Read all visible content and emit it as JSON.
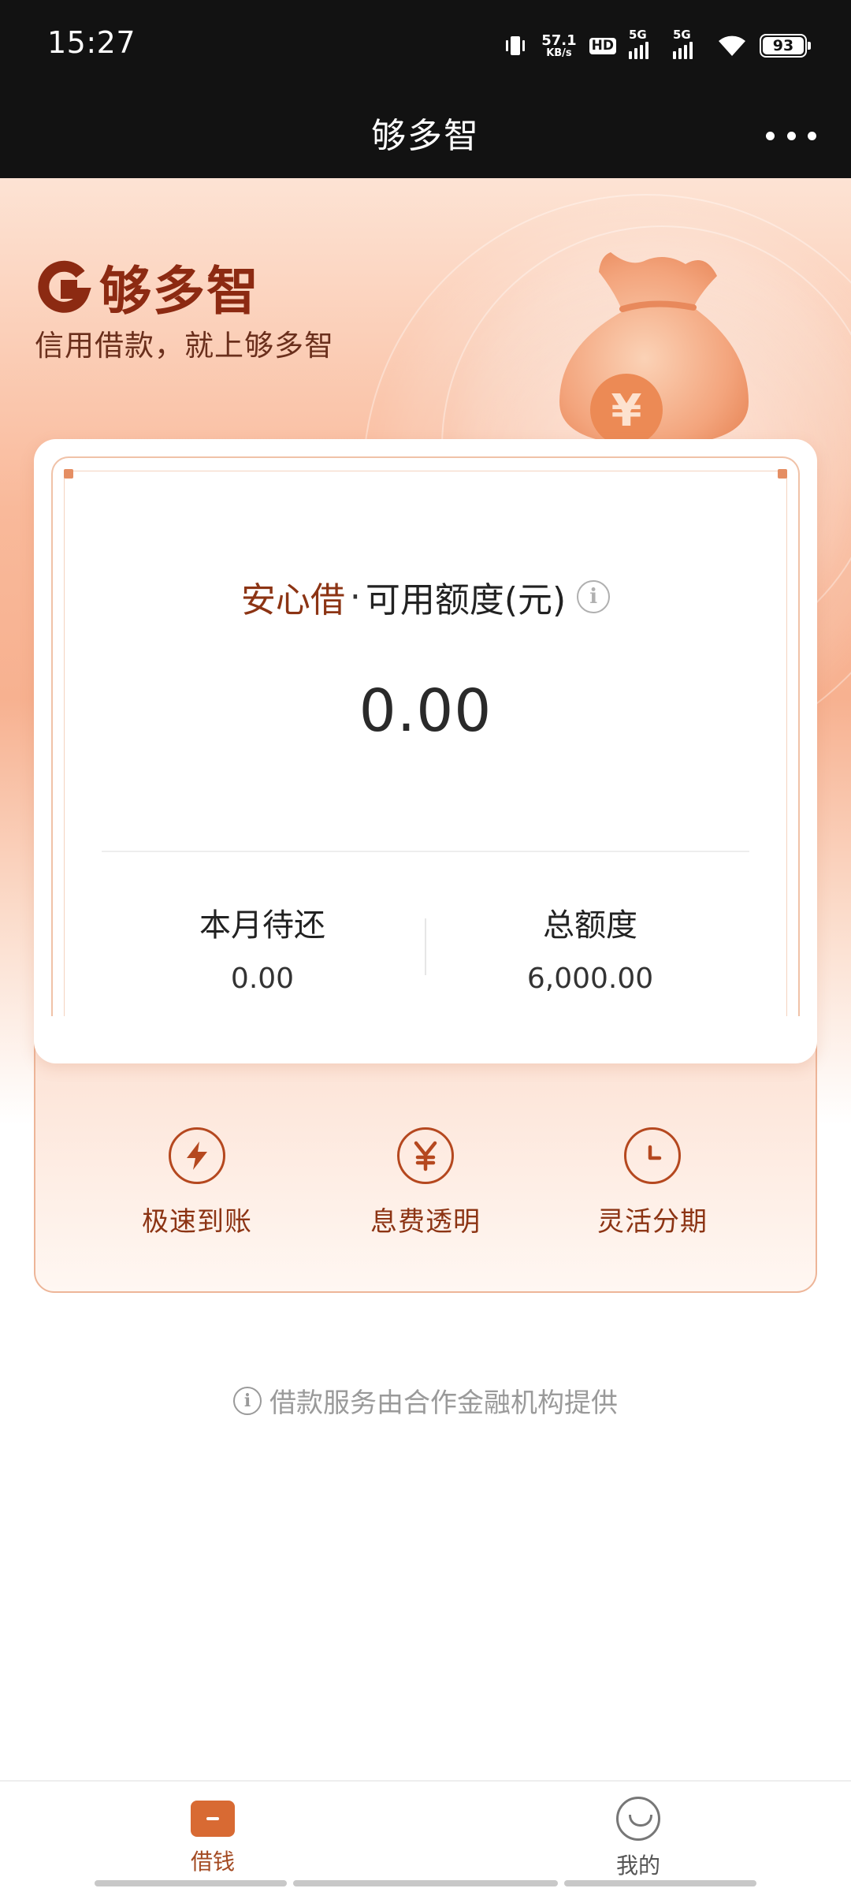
{
  "status_bar": {
    "time": "15:27",
    "net_speed_value": "57.1",
    "net_speed_unit": "KB/s",
    "hd_label": "HD",
    "sim1_label": "5G",
    "sim2_label": "5G",
    "battery": "93"
  },
  "title_bar": {
    "title": "够多智"
  },
  "hero": {
    "brand_name": "够多智",
    "slogan": "信用借款，就上够多智"
  },
  "credit_card": {
    "product_name": "安心借",
    "separator": "·",
    "available_label": "可用额度(元)",
    "available_amount": "0.00",
    "stats": [
      {
        "label": "本月待还",
        "value": "0.00"
      },
      {
        "label": "总额度",
        "value": "6,000.00"
      }
    ]
  },
  "features": [
    {
      "label": "极速到账",
      "icon": "lightning-icon"
    },
    {
      "label": "息费透明",
      "icon": "yen-icon"
    },
    {
      "label": "灵活分期",
      "icon": "clock-icon"
    }
  ],
  "disclaimer": "借款服务由合作金融机构提供",
  "bottom_nav": {
    "items": [
      {
        "label": "借钱",
        "icon": "wallet-icon",
        "active": true
      },
      {
        "label": "我的",
        "icon": "smile-icon",
        "active": false
      }
    ]
  },
  "colors": {
    "brand": "#8c2a12",
    "accent": "#d86a33",
    "feature_text": "#8c3414"
  }
}
